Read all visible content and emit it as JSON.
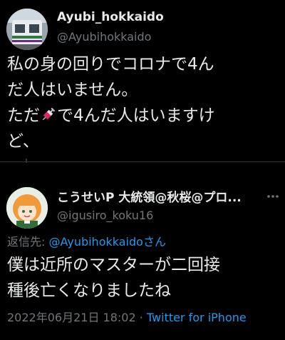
{
  "tweet": {
    "author_name": "Ayubi_hokkaido",
    "author_handle": "@Ayubihokkaido",
    "text_lines": [
      "私の身の回りでコロナで4ん",
      "だ人はいません。",
      "ただ",
      "で4んだ人はいますけ",
      "ど、"
    ],
    "avatar_icon": "train-avatar",
    "emoji_icon": "syringe-icon"
  },
  "reply": {
    "author_name": "こうせいP 大統領@秋桜@プロ...",
    "author_handle": "@igusiro_koku16",
    "reply_label": "返信先: ",
    "reply_mention": "@Ayubihokkaido",
    "reply_suffix": "さん",
    "text_lines": [
      "僕は近所のマスターが二回接",
      "種後亡くなりましたね"
    ],
    "timestamp": "2022年06月21日 18:02 · ",
    "source": "Twitter for iPhone",
    "avatar_icon": "anime-character-avatar"
  },
  "colors": {
    "background": "#000000",
    "text": "#e7e9ea",
    "secondary": "#71767b",
    "accent": "#1d9bf0"
  }
}
